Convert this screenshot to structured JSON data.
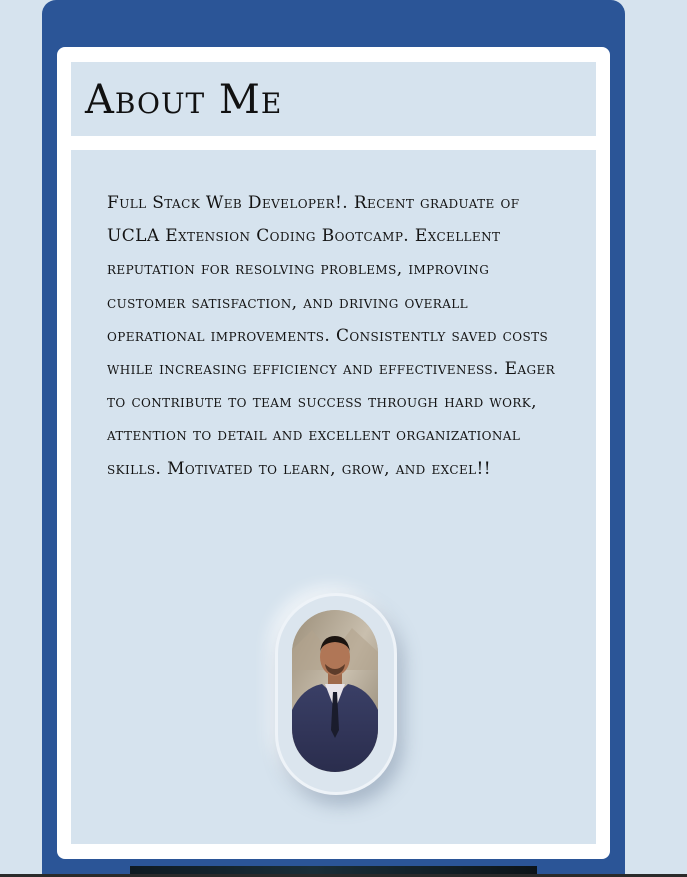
{
  "header": {
    "title": "About Me"
  },
  "about": {
    "bio": "Full Stack Web Developer!. Recent graduate of UCLA Extension Coding Bootcamp. Excellent reputation for resolving problems, improving customer satisfaction, and driving overall operational improvements. Consistently saved costs while increasing efficiency and effectiveness. Eager to contribute to team success through hard work, attention to detail and excellent organizational skills. Motivated to learn, grow, and excel!!"
  },
  "colors": {
    "page_background": "#d6e3ee",
    "card_border": "#2b5597",
    "card_inner": "#ffffff",
    "text": "#141414"
  }
}
